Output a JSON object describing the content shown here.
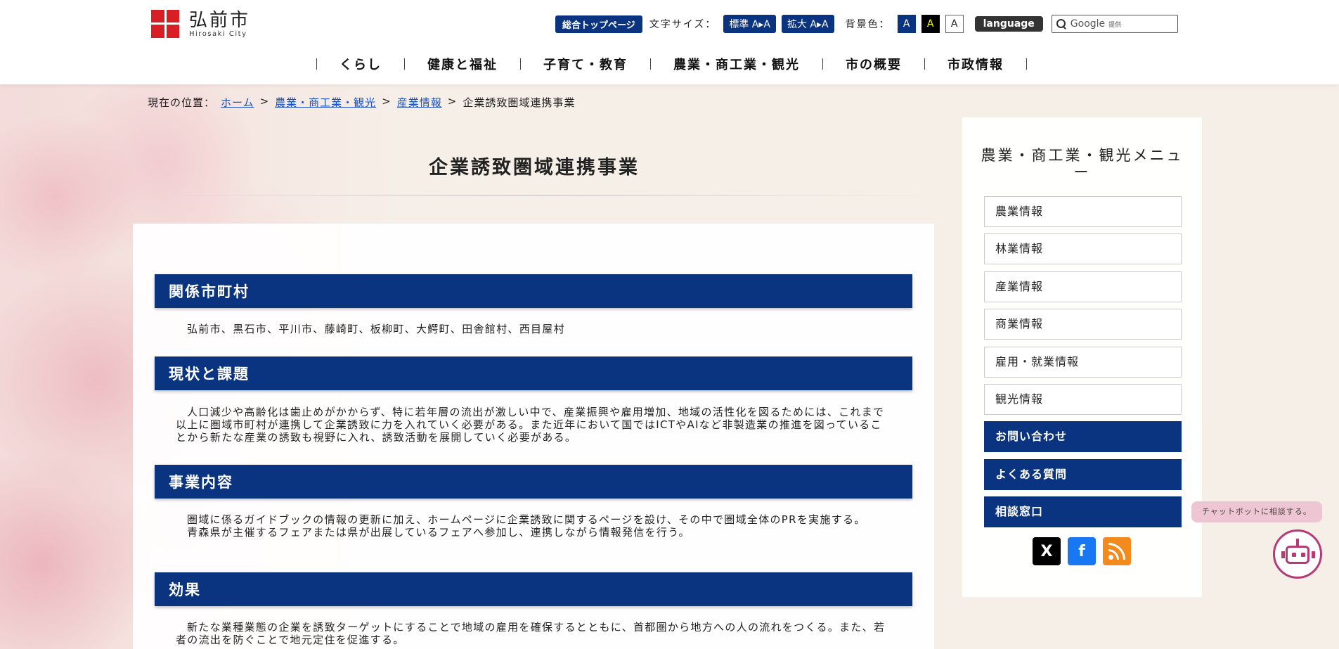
{
  "header": {
    "logo_name": "弘前市",
    "logo_sub": "Hirosaki City",
    "top_page": "総合トップページ",
    "font_size_label": "文字サイズ：",
    "size_standard": "標準 A▸A",
    "size_large": "拡大 A▸A",
    "bg_label": "背景色：",
    "bg_options": [
      "A",
      "A",
      "A"
    ],
    "language": "language",
    "search_placeholder": "Google",
    "search_provided": "提供"
  },
  "gnav": [
    "くらし",
    "健康と福祉",
    "子育て・教育",
    "農業・商工業・観光",
    "市の概要",
    "市政情報"
  ],
  "breadcrumb": {
    "label": "現在の位置：",
    "links": [
      "ホーム",
      "農業・商工業・観光",
      "産業情報"
    ],
    "separator": ">",
    "current": "企業誘致圏域連携事業"
  },
  "page_title": "企業誘致圏域連携事業",
  "sections": [
    {
      "heading": "関係市町村",
      "paragraphs": [
        "弘前市、黒石市、平川市、藤崎町、板柳町、大鰐町、田舎館村、西目屋村"
      ]
    },
    {
      "heading": "現状と課題",
      "paragraphs": [
        "人口減少や高齢化は歯止めがかからず、特に若年層の流出が激しい中で、産業振興や雇用増加、地域の活性化を図るためには、これまで以上に圏域市町村が連携して企業誘致に力を入れていく必要がある。また近年において国ではICTやAIなど非製造業の推進を図っていることから新たな産業の誘致も視野に入れ、誘致活動を展開していく必要がある。"
      ]
    },
    {
      "heading": "事業内容",
      "paragraphs": [
        "圏域に係るガイドブックの情報の更新に加え、ホームページに企業誘致に関するページを設け、その中で圏域全体のPRを実施する。",
        "青森県が主催するフェアまたは県が出展しているフェアへ参加し、連携しながら情報発信を行う。"
      ]
    },
    {
      "heading": "効果",
      "paragraphs": [
        "新たな業種業態の企業を誘致ターゲットにすることで地域の雇用を確保するとともに、首都圏から地方への人の流れをつくる。また、若者の流出を防ぐことで地元定住を促進する。"
      ]
    }
  ],
  "sidebar": {
    "title": "農業・商工業・観光メニュー",
    "items": [
      "農業情報",
      "林業情報",
      "産業情報",
      "商業情報",
      "雇用・就業情報",
      "観光情報"
    ],
    "dark_items": [
      "お問い合わせ",
      "よくある質問",
      "相談窓口"
    ],
    "social": [
      "X",
      "f"
    ]
  },
  "chat": {
    "bubble": "チャットボットに相談する。"
  },
  "colors": {
    "navy": "#0a3380",
    "brand_red": "#d91f26",
    "chatbot": "#b53a75"
  }
}
